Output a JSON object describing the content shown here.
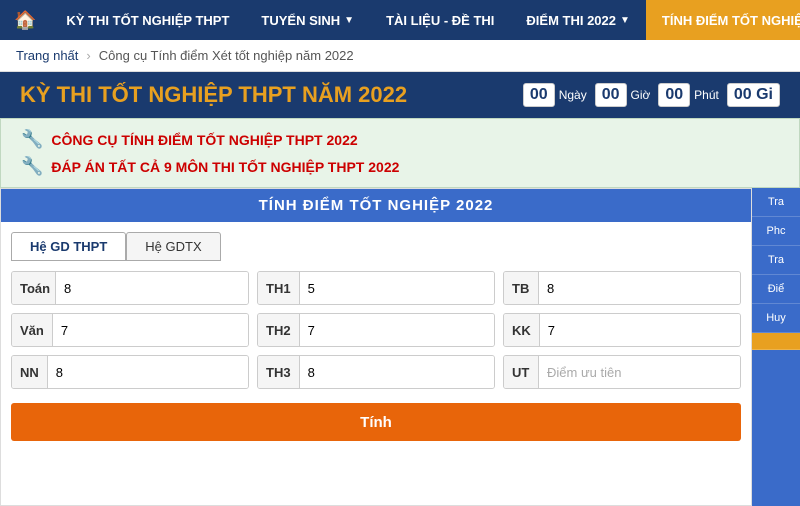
{
  "navbar": {
    "home_icon": "🏠",
    "items": [
      {
        "label": "KỲ THI TỐT NGHIỆP THPT",
        "active": false,
        "has_arrow": false
      },
      {
        "label": "TUYỂN SINH",
        "active": false,
        "has_arrow": true
      },
      {
        "label": "TÀI LIỆU - ĐỀ THI",
        "active": false,
        "has_arrow": false
      },
      {
        "label": "ĐIỂM THI 2022",
        "active": false,
        "has_arrow": true
      },
      {
        "label": "TÍNH ĐIỂM TỐT NGHIỆP",
        "active": true,
        "has_arrow": false
      }
    ]
  },
  "breadcrumb": {
    "home": "Trang nhất",
    "sep": "›",
    "current": "Công cụ Tính điểm Xét tốt nghiệp năm 2022"
  },
  "hero": {
    "title": "KỲ THI TỐT NGHIỆP THPT NĂM 2022",
    "countdown": {
      "ngay": "00",
      "gio": "00",
      "phut": "00",
      "giay_label": "00 Gi"
    },
    "labels": {
      "ngay": "Ngày",
      "gio": "Giờ",
      "phut": "Phút"
    }
  },
  "tools": {
    "tool1": "CÔNG CỤ TÍNH ĐIỂM TỐT NGHIỆP THPT 2022",
    "tool2": "ĐÁP ÁN TẤT CẢ 9 MÔN THI TỐT NGHIỆP THPT 2022"
  },
  "calculator": {
    "title": "TÍNH ĐIỂM TỐT NGHIỆP 2022",
    "tabs": [
      {
        "label": "Hệ GD THPT",
        "active": true
      },
      {
        "label": "Hệ GDTX",
        "active": false
      }
    ],
    "scores": [
      {
        "label": "Toán",
        "value": "8",
        "col": 1
      },
      {
        "label": "TH1",
        "value": "5",
        "col": 2
      },
      {
        "label": "TB",
        "value": "8",
        "col": 3
      },
      {
        "label": "Văn",
        "value": "7",
        "col": 1
      },
      {
        "label": "TH2",
        "value": "7",
        "col": 2
      },
      {
        "label": "KK",
        "value": "7",
        "col": 3
      },
      {
        "label": "NN",
        "value": "8",
        "col": 1
      },
      {
        "label": "TH3",
        "value": "8",
        "col": 2
      },
      {
        "label": "UT",
        "value": "",
        "placeholder": "Điểm ưu tiên",
        "col": 3
      }
    ],
    "btn_label": "Tính"
  },
  "sidebar": {
    "items": [
      {
        "label": "Tra"
      },
      {
        "label": "Phc"
      },
      {
        "label": "Tra"
      },
      {
        "label": "Điể"
      },
      {
        "label": "Huy"
      },
      {
        "label": ""
      }
    ]
  }
}
